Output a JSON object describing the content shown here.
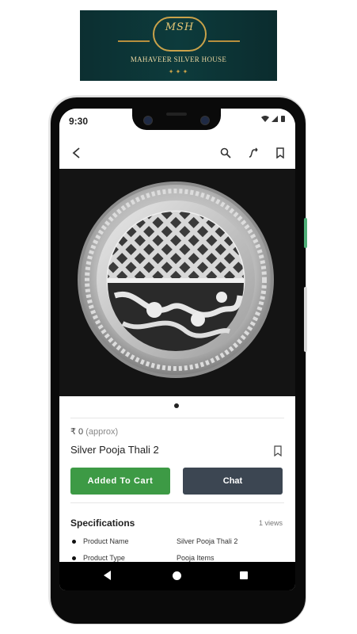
{
  "logo": {
    "monogram": "MSH",
    "brand_name": "MAHAVEER SILVER HOUSE"
  },
  "status_bar": {
    "time": "9:30",
    "icons": [
      "wifi-icon",
      "signal-icon",
      "battery-icon"
    ]
  },
  "app_bar": {
    "icons": [
      "back-arrow-icon",
      "search-icon",
      "share-icon",
      "bookmark-icon"
    ]
  },
  "product": {
    "price": "₹ 0",
    "price_note": "(approx)",
    "name": "Silver Pooja Thali 2",
    "carousel_index": 1,
    "carousel_total": 1
  },
  "actions": {
    "cart_label": "Added To Cart",
    "chat_label": "Chat"
  },
  "specifications": {
    "title": "Specifications",
    "views": "1 views",
    "rows": [
      {
        "key": "Product Name",
        "value": "Silver Pooja Thali 2"
      },
      {
        "key": "Product Type",
        "value": "Pooja Items"
      }
    ]
  },
  "nav_bar": {
    "icons": [
      "back-triangle-icon",
      "home-circle-icon",
      "recents-square-icon"
    ]
  },
  "colors": {
    "accent_green": "#3d9a45",
    "chat_button": "#3c4652",
    "logo_background": "#0d3b3c",
    "logo_gold": "#c9a24a"
  }
}
